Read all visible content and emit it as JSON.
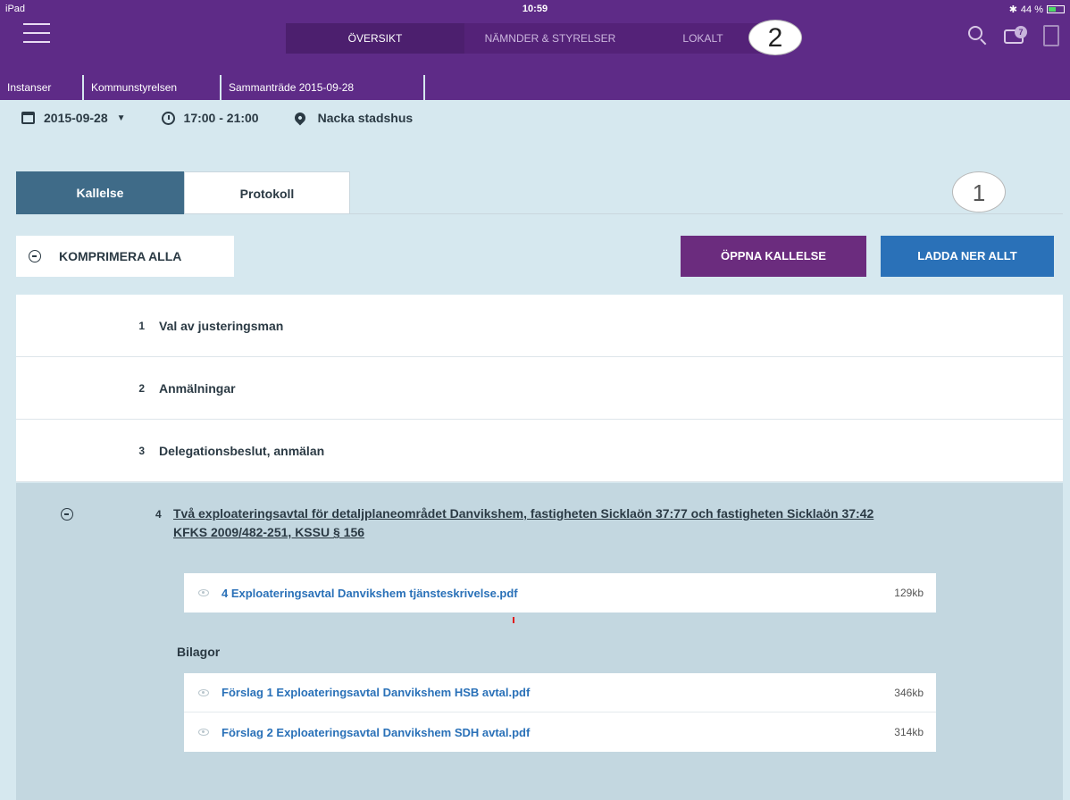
{
  "status_bar": {
    "carrier": "iPad",
    "time": "10:59",
    "battery": "44 %"
  },
  "nav": {
    "tabs": [
      {
        "label": "ÖVERSIKT",
        "active": true
      },
      {
        "label": "NÄMNDER & STYRELSER",
        "active": false
      },
      {
        "label": "LOKALT",
        "active": false
      }
    ],
    "annotation_badge": "2",
    "notification_count": "7"
  },
  "breadcrumb": [
    "Instanser",
    "Kommunstyrelsen",
    "Sammanträde 2015-09-28"
  ],
  "meeting": {
    "date": "2015-09-28",
    "time": "17:00 - 21:00",
    "location": "Nacka stadshus"
  },
  "content_tabs": [
    {
      "label": "Kallelse",
      "active": true
    },
    {
      "label": "Protokoll",
      "active": false
    }
  ],
  "annotation_badge_1": "1",
  "actions": {
    "collapse_all": "KOMPRIMERA ALLA",
    "open_notice": "ÖPPNA KALLELSE",
    "download_all": "LADDA NER ALLT"
  },
  "agenda": [
    {
      "num": "1",
      "title": "Val av justeringsman"
    },
    {
      "num": "2",
      "title": "Anmälningar"
    },
    {
      "num": "3",
      "title": "Delegationsbeslut, anmälan"
    }
  ],
  "expanded_item": {
    "num": "4",
    "title": "Två exploateringsavtal för detaljplaneområdet Danvikshem, fastigheten Sicklaön 37:77 och fastigheten Sicklaön 37:42 KFKS 2009/482-251, KSSU § 156",
    "main_file": {
      "name": "4 Exploateringsavtal Danvikshem tjänsteskrivelse.pdf",
      "size": "129kb"
    },
    "attachments_label": "Bilagor",
    "attachments": [
      {
        "name": "Förslag 1 Exploateringsavtal Danvikshem HSB avtal.pdf",
        "size": "346kb"
      },
      {
        "name": "Förslag 2 Exploateringsavtal Danvikshem SDH avtal.pdf",
        "size": "314kb"
      }
    ]
  },
  "colors": {
    "brand_purple": "#5e2b87",
    "tab_active": "#3f6b88",
    "open_button": "#6b2c7e",
    "download_button": "#2a71b8",
    "page_bg": "#d6e8ef"
  }
}
